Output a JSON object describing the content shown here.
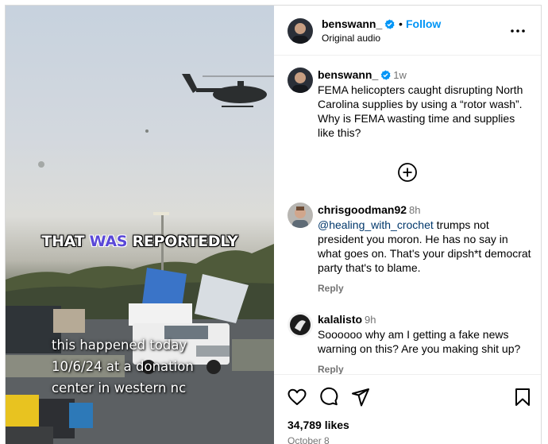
{
  "post": {
    "username": "benswann_",
    "follow_label": "Follow",
    "dot_separator": "•",
    "audio_label": "Original audio"
  },
  "video": {
    "caption_top_parts": [
      "THAT ",
      "WAS",
      " REPORTEDLY"
    ],
    "caption_bottom": [
      "this happened today",
      "10/6/24 at a donation",
      "center in western nc"
    ]
  },
  "comments": [
    {
      "username": "benswann_",
      "verified": true,
      "time": "1w",
      "text": "FEMA helicopters caught disrupting North Carolina supplies by using a “rotor wash”. Why is FEMA wasting time and supplies like this?"
    },
    {
      "username": "chrisgoodman92",
      "time": "8h",
      "mention": "@healing_with_crochet",
      "text": " trumps not president you moron. He has no say in what goes on. That's your dipsh*t democrat party that's to blame.",
      "reply_label": "Reply"
    },
    {
      "username": "kalalisto",
      "time": "9h",
      "text": "Soooooo why am I getting a fake news warning on this? Are you making shit up?",
      "reply_label": "Reply"
    }
  ],
  "footer": {
    "likes": "34,789 likes",
    "date": "October 8"
  },
  "colors": {
    "accent": "#0095f6",
    "verified": "#0095f6",
    "muted": "#737373",
    "caption_highlight": "#5a48d8"
  },
  "icons": [
    "verified-badge-icon",
    "more-options-icon",
    "load-more-comments-icon",
    "heart-icon",
    "comment-icon",
    "share-icon",
    "save-icon"
  ]
}
